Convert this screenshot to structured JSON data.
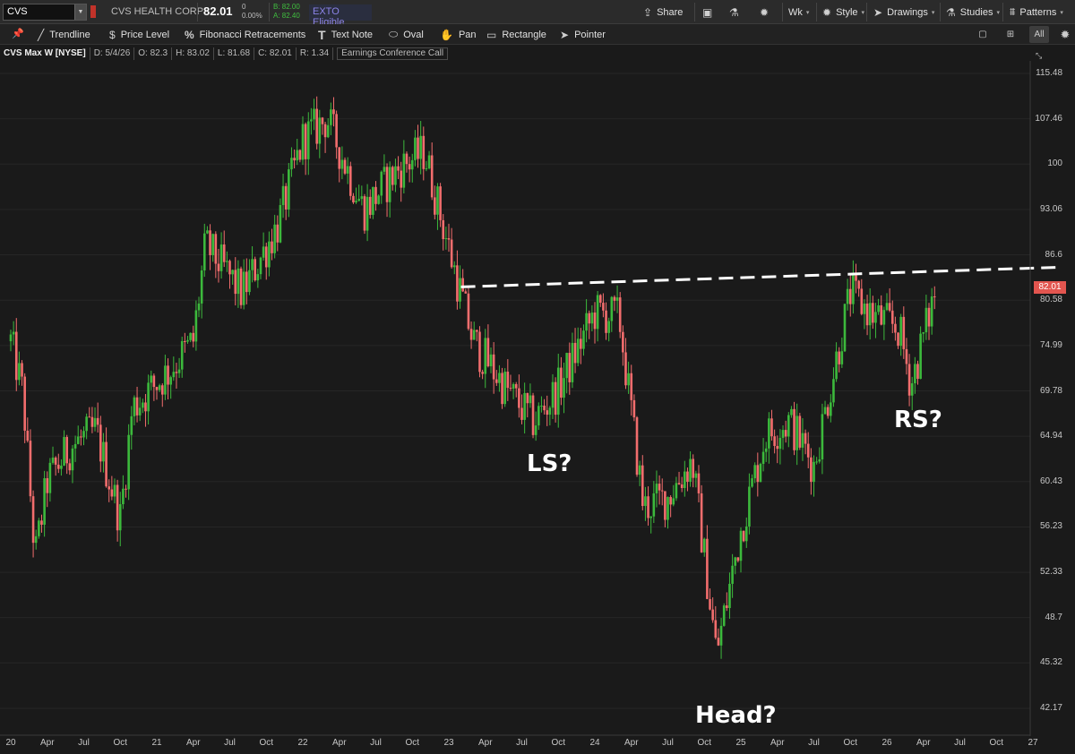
{
  "header": {
    "symbol": "CVS",
    "company": "CVS HEALTH CORP",
    "last": "82.01",
    "change_top": "0",
    "change_pct": "0.00%",
    "bid": "B: 82.00",
    "ask": "A: 82.40",
    "exto": "EXTO Eligible",
    "buttons": {
      "share": "Share",
      "timeframe": "Wk",
      "style": "Style",
      "drawings": "Drawings",
      "studies": "Studies",
      "patterns": "Patterns"
    }
  },
  "drawing_tools": {
    "trendline": "Trendline",
    "price_level": "Price Level",
    "fibonacci": "Fibonacci Retracements",
    "text_note": "Text Note",
    "oval": "Oval",
    "pan": "Pan",
    "rectangle": "Rectangle",
    "pointer": "Pointer",
    "view_all": "All"
  },
  "info": {
    "title": "CVS Max W [NYSE]",
    "date": "D: 5/4/26",
    "open": "O: 82.3",
    "high": "H: 83.02",
    "low": "L: 81.68",
    "close": "C: 82.01",
    "range": "R: 1.34",
    "event": "Earnings Conference Call"
  },
  "chart_data": {
    "type": "candlestick",
    "y_ticks": [
      "115.48",
      "107.46",
      "100",
      "93.06",
      "86.6",
      "80.58",
      "74.99",
      "69.78",
      "64.94",
      "60.43",
      "56.23",
      "52.33",
      "48.7",
      "45.32",
      "42.17"
    ],
    "x_ticks": [
      "20",
      "Apr",
      "Jul",
      "Oct",
      "21",
      "Apr",
      "Jul",
      "Oct",
      "22",
      "Apr",
      "Jul",
      "Oct",
      "23",
      "Apr",
      "Jul",
      "Oct",
      "24",
      "Apr",
      "Jul",
      "Oct",
      "25",
      "Apr",
      "Jul",
      "Oct",
      "26",
      "Apr",
      "Jul",
      "Oct",
      "27"
    ],
    "current_price": "82.01",
    "scale": "log",
    "colors": {
      "up": "#3cb93c",
      "down": "#f26d6d",
      "background": "#1a1a1a",
      "trendline": "#ffffff"
    },
    "annotations": [
      "LS?",
      "Head?",
      "RS?"
    ],
    "trendline": {
      "from": {
        "x": "2023-02",
        "y": 82.3
      },
      "to": {
        "x": "2027-03",
        "y": 84.9
      },
      "style": "dashed"
    },
    "path": [
      {
        "x": "2020-01",
        "y": 75.5
      },
      {
        "x": "2020-02",
        "y": 69.5
      },
      {
        "x": "2020-03",
        "y": 53.5
      },
      {
        "x": "2020-04",
        "y": 60.5
      },
      {
        "x": "2020-06",
        "y": 64.0
      },
      {
        "x": "2020-08",
        "y": 65.5
      },
      {
        "x": "2020-10",
        "y": 57.0
      },
      {
        "x": "2020-11",
        "y": 68.0
      },
      {
        "x": "2021-02",
        "y": 72.0
      },
      {
        "x": "2021-04",
        "y": 75.5
      },
      {
        "x": "2021-05",
        "y": 88.0
      },
      {
        "x": "2021-08",
        "y": 81.5
      },
      {
        "x": "2021-11",
        "y": 91.0
      },
      {
        "x": "2022-01",
        "y": 104.0
      },
      {
        "x": "2022-03",
        "y": 107.5
      },
      {
        "x": "2022-06",
        "y": 93.0
      },
      {
        "x": "2022-09",
        "y": 99.5
      },
      {
        "x": "2022-11",
        "y": 102.0
      },
      {
        "x": "2023-01",
        "y": 87.5
      },
      {
        "x": "2023-03",
        "y": 75.5
      },
      {
        "x": "2023-06",
        "y": 69.5
      },
      {
        "x": "2023-08",
        "y": 66.5
      },
      {
        "x": "2023-10",
        "y": 70.0
      },
      {
        "x": "2024-01",
        "y": 79.0
      },
      {
        "x": "2024-03",
        "y": 78.5
      },
      {
        "x": "2024-05",
        "y": 58.0
      },
      {
        "x": "2024-07",
        "y": 59.0
      },
      {
        "x": "2024-09",
        "y": 62.5
      },
      {
        "x": "2024-11",
        "y": 46.0
      },
      {
        "x": "2025-01",
        "y": 56.0
      },
      {
        "x": "2025-03",
        "y": 65.0
      },
      {
        "x": "2025-05",
        "y": 66.5
      },
      {
        "x": "2025-07",
        "y": 62.0
      },
      {
        "x": "2025-09",
        "y": 74.5
      },
      {
        "x": "2025-10",
        "y": 81.5
      },
      {
        "x": "2025-12",
        "y": 78.5
      },
      {
        "x": "2026-02",
        "y": 77.0
      },
      {
        "x": "2026-03",
        "y": 70.5
      },
      {
        "x": "2026-05",
        "y": 82.0
      }
    ]
  }
}
